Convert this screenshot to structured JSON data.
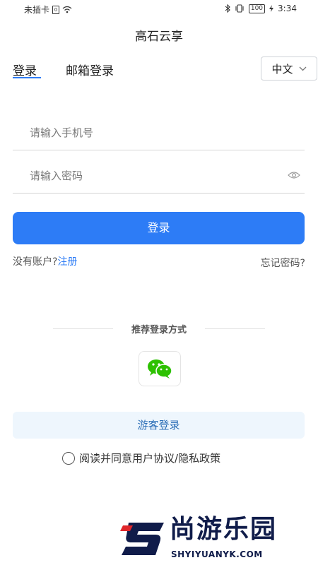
{
  "status_bar": {
    "carrier": "未插卡",
    "battery": "100",
    "time": "3:34"
  },
  "app_title": "高石云享",
  "tabs": {
    "login": "登录",
    "email_login": "邮箱登录"
  },
  "language": {
    "selected": "中文"
  },
  "form": {
    "phone_placeholder": "请输入手机号",
    "password_placeholder": "请输入密码",
    "login_button": "登录"
  },
  "register": {
    "prompt": "没有账户?",
    "link": "注册"
  },
  "forgot_password": "忘记密码?",
  "recommended_login": "推荐登录方式",
  "guest_login": "游客登录",
  "agreement": {
    "prefix": "阅读并同意",
    "user_agreement": "用户协议",
    "separator": "/",
    "privacy_policy": "隐私政策"
  },
  "watermark": {
    "name": "尚游乐园",
    "domain": "SHYIYUANYK.COM"
  },
  "colors": {
    "primary": "#2d7cf6",
    "guest_bg": "#eef6fd",
    "wechat_green": "#2dc100"
  }
}
